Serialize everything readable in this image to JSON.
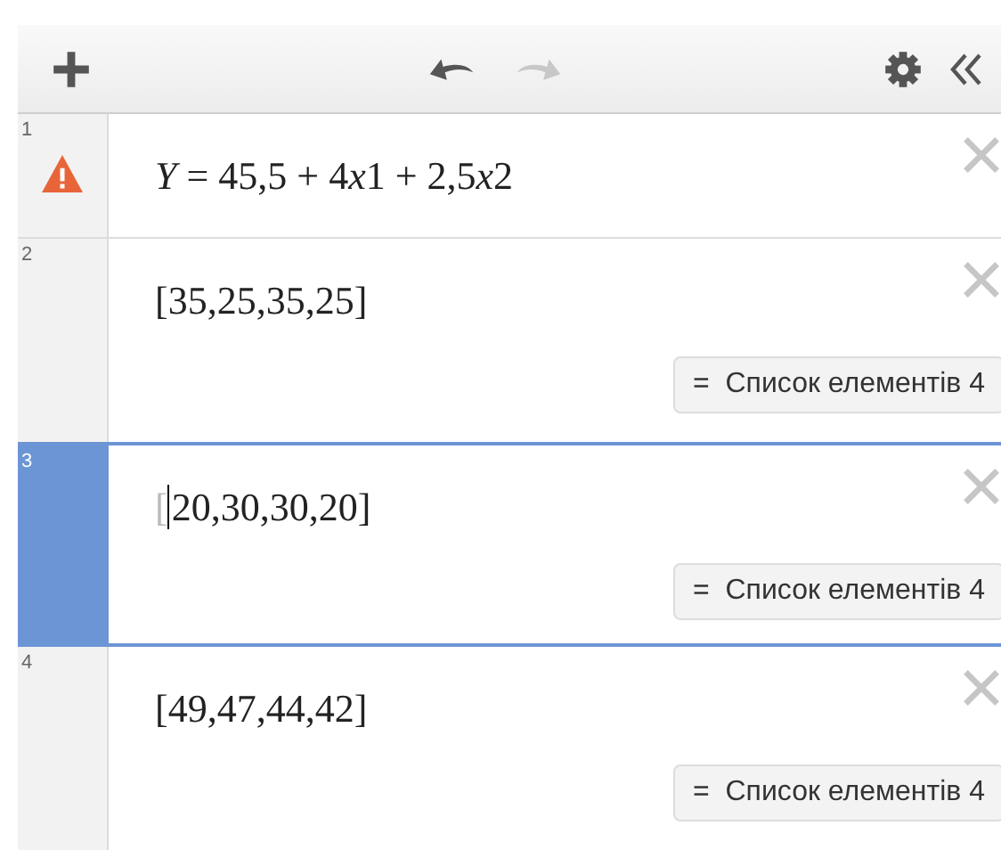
{
  "toolbar": {
    "redo_disabled": true
  },
  "expressions": [
    {
      "number": "1",
      "warning": true,
      "selected": false,
      "segments": [
        {
          "text": "Y",
          "kind": "var"
        },
        {
          "text": " = 45,5 + 4",
          "kind": "plain"
        },
        {
          "text": "x",
          "kind": "var"
        },
        {
          "text": "1 + 2,5",
          "kind": "plain"
        },
        {
          "text": "x",
          "kind": "var"
        },
        {
          "text": "2",
          "kind": "plain"
        }
      ]
    },
    {
      "number": "2",
      "warning": false,
      "selected": false,
      "segments": [
        {
          "text": "[35,25,35,25]",
          "kind": "plain"
        }
      ],
      "result": {
        "symbol": "=",
        "label": "Список елементів 4"
      }
    },
    {
      "number": "3",
      "warning": false,
      "selected": true,
      "segments": [
        {
          "text": "[",
          "kind": "faded"
        },
        {
          "text": "20,30,30,20]",
          "kind": "cursor"
        }
      ],
      "result": {
        "symbol": "=",
        "label": "Список елементів 4"
      }
    },
    {
      "number": "4",
      "warning": false,
      "selected": false,
      "segments": [
        {
          "text": "[49,47,44,42]",
          "kind": "plain"
        }
      ],
      "result": {
        "symbol": "=",
        "label": "Список елементів 4"
      }
    }
  ]
}
